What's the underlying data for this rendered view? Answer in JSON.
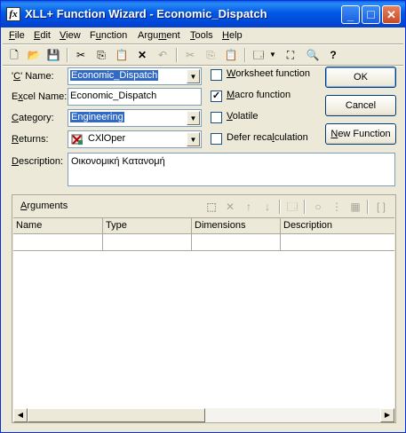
{
  "window": {
    "title": "XLL+ Function Wizard - Economic_Dispatch",
    "app_icon_glyph": "fx",
    "minimize_glyph": "_",
    "maximize_glyph": "□",
    "close_glyph": "✕"
  },
  "menu": [
    {
      "label": "File",
      "accel": "F",
      "rest": "ile"
    },
    {
      "label": "Edit",
      "accel": "E",
      "rest": "dit"
    },
    {
      "label": "View",
      "accel": "V",
      "rest": "iew"
    },
    {
      "label": "Function",
      "pre": "F",
      "accel": "u",
      "rest": "nction"
    },
    {
      "label": "Argument",
      "pre": "Argu",
      "accel": "m",
      "rest": "ent"
    },
    {
      "label": "Tools",
      "accel": "T",
      "rest": "ools"
    },
    {
      "label": "Help",
      "accel": "H",
      "rest": "elp"
    }
  ],
  "toolbar": {
    "icons": [
      "new-file-icon",
      "open-folder-icon",
      "save-icon",
      "cut-icon",
      "copy-icon",
      "paste-icon",
      "delete-icon",
      "undo-icon",
      "cut-disabled-icon",
      "copy-disabled-icon",
      "paste-disabled-icon",
      "properties-icon",
      "dropdown-arrow-icon",
      "resize-icon",
      "print-preview-icon",
      "help-icon"
    ]
  },
  "form": {
    "c_name": {
      "label_pre": "'",
      "label_accel": "C",
      "label_rest": "' Name:",
      "value": "Economic_Dispatch"
    },
    "excel_name": {
      "label_pre": "E",
      "label_accel": "x",
      "label_rest": "cel Name:",
      "value": "Economic_Dispatch"
    },
    "category": {
      "label_accel": "C",
      "label_rest": "ategory:",
      "value": "Engineering"
    },
    "returns": {
      "label_accel": "R",
      "label_rest": "eturns:",
      "value": "CXlOper"
    },
    "description": {
      "label_accel": "D",
      "label_rest": "escription:",
      "value": "Οικονομική Κατανομή"
    }
  },
  "checkboxes": [
    {
      "label_accel": "W",
      "label_rest": "orksheet function",
      "checked": false,
      "mark": ""
    },
    {
      "label_accel": "M",
      "label_rest": "acro function",
      "checked": true,
      "mark": "✓"
    },
    {
      "label_accel": "V",
      "label_rest": "olatile",
      "checked": false,
      "mark": ""
    },
    {
      "label_pre": "Defer reca",
      "label_accel": "l",
      "label_rest": "culation",
      "checked": false,
      "mark": ""
    }
  ],
  "buttons": {
    "ok": "OK",
    "cancel": "Cancel",
    "new_function": {
      "accel": "N",
      "rest": "ew Function"
    }
  },
  "arguments": {
    "header": {
      "pre": "",
      "accel": "A",
      "rest": "rguments"
    },
    "columns": [
      "Name",
      "Type",
      "Dimensions",
      "Description"
    ],
    "rows": [
      [
        "",
        "",
        "",
        ""
      ]
    ]
  }
}
